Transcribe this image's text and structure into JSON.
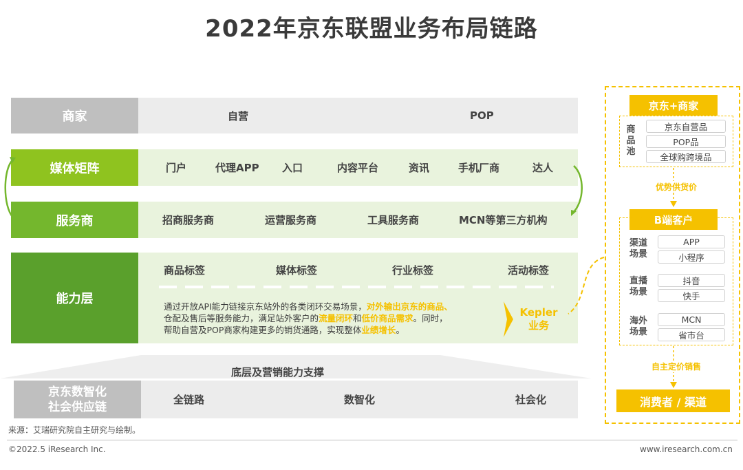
{
  "title": "2022年京东联盟业务布局链路",
  "rows": {
    "merchant": {
      "label": "商家",
      "items": [
        "自营",
        "POP"
      ]
    },
    "media": {
      "label": "媒体矩阵",
      "items": [
        "门户",
        "代理APP",
        "入口",
        "内容平台",
        "资讯",
        "手机厂商",
        "达人"
      ]
    },
    "service": {
      "label": "服务商",
      "items": [
        "招商服务商",
        "运营服务商",
        "工具服务商",
        "MCN等第三方机构"
      ]
    },
    "capability": {
      "label": "能力层",
      "tags": [
        "商品标签",
        "媒体标签",
        "行业标签",
        "活动标签"
      ],
      "desc_line1_a": "通过开放API能力链接京东站外的各类闭环交易场景，",
      "desc_line1_hl": "对外输出京东的商品、",
      "desc_line2_a": "仓配及售后等服务能力，满足站外客户的",
      "desc_line2_hl1": "流量闭环",
      "desc_line2_b": "和",
      "desc_line2_hl2": "低价商品需求",
      "desc_line2_c": "。同时，",
      "desc_line3_a": "帮助自营及POP商家构建更多的销货通路，实现整体",
      "desc_line3_hl": "业绩增长",
      "desc_line3_b": "。",
      "kepler_1": "Kepler",
      "kepler_2": "业务"
    },
    "foundation": {
      "caption": "底层及营销能力支撑",
      "label_1": "京东数智化",
      "label_2": "社会供应链",
      "items": [
        "全链路",
        "数智化",
        "社会化"
      ]
    }
  },
  "right_panel": {
    "jd_merchant": "京东+商家",
    "pool_label": [
      "商",
      "品",
      "池"
    ],
    "pool_items": [
      "京东自营品",
      "POP品",
      "全球购跨境品"
    ],
    "arrow1_label": "优势供货价",
    "b_client": "B端客户",
    "groups": [
      {
        "label": [
          "渠道",
          "场景"
        ],
        "items": [
          "APP",
          "小程序"
        ]
      },
      {
        "label": [
          "直播",
          "场景"
        ],
        "items": [
          "抖音",
          "快手"
        ]
      },
      {
        "label": [
          "海外",
          "场景"
        ],
        "items": [
          "MCN",
          "省市台"
        ]
      }
    ],
    "arrow2_label": "自主定价销售",
    "consumer": "消费者 / 渠道"
  },
  "footer": {
    "source": "来源：艾瑞研究院自主研究与绘制。",
    "copyright": "©2022.5 iResearch Inc.",
    "website": "www.iresearch.com.cn"
  },
  "colors": {
    "green_1": "#8fc31f",
    "green_2": "#74b72d",
    "green_3": "#5aa02c",
    "light_green": "#e9f3dd",
    "gray_header": "#bfbfbf",
    "gray_body": "#ececec",
    "accent_yellow": "#f5c100"
  }
}
